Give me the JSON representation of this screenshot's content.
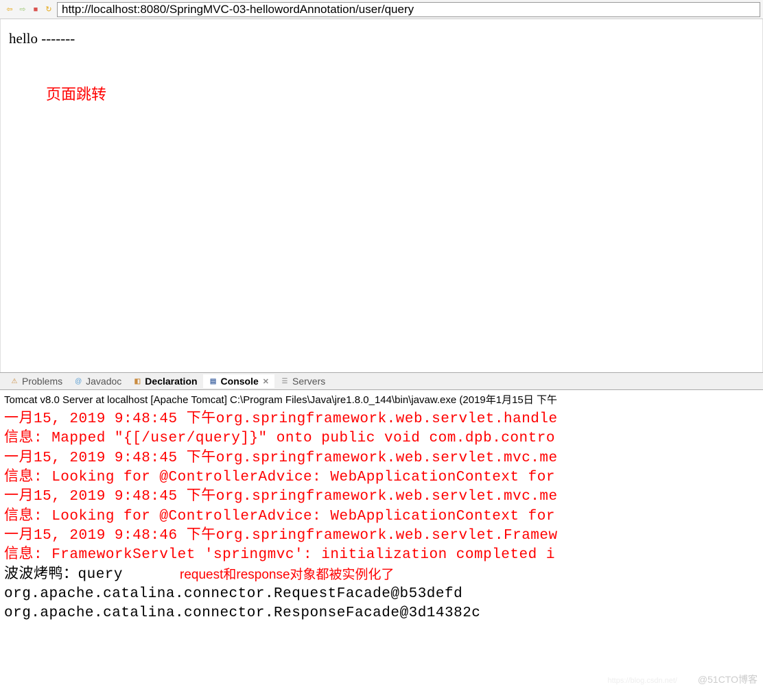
{
  "toolbar": {
    "url": "http://localhost:8080/SpringMVC-03-hellowordAnnotation/user/query"
  },
  "browser": {
    "body_text": "hello -------"
  },
  "annotations": {
    "page_redirect": "页面跳转",
    "request_response": "request和response对象都被实例化了"
  },
  "tabs": [
    {
      "label": "Problems",
      "icon": "problems"
    },
    {
      "label": "Javadoc",
      "icon": "javadoc"
    },
    {
      "label": "Declaration",
      "icon": "declaration",
      "bold": true
    },
    {
      "label": "Console",
      "icon": "console",
      "active": true
    },
    {
      "label": "Servers",
      "icon": "servers"
    }
  ],
  "console": {
    "header": "Tomcat v8.0 Server at localhost [Apache Tomcat] C:\\Program Files\\Java\\jre1.8.0_144\\bin\\javaw.exe (2019年1月15日 下午",
    "lines": [
      {
        "color": "red",
        "text": "一月15, 2019 9:48:45 下午org.springframework.web.servlet.handle"
      },
      {
        "color": "red",
        "text": "信息: Mapped \"{[/user/query]}\" onto public void com.dpb.contro"
      },
      {
        "color": "red",
        "text": "一月15, 2019 9:48:45 下午org.springframework.web.servlet.mvc.me"
      },
      {
        "color": "red",
        "text": "信息: Looking for @ControllerAdvice: WebApplicationContext for"
      },
      {
        "color": "red",
        "text": "一月15, 2019 9:48:45 下午org.springframework.web.servlet.mvc.me"
      },
      {
        "color": "red",
        "text": "信息: Looking for @ControllerAdvice: WebApplicationContext for"
      },
      {
        "color": "red",
        "text": "一月15, 2019 9:48:46 下午org.springframework.web.servlet.Framew"
      },
      {
        "color": "red",
        "text": "信息: FrameworkServlet 'springmvc': initialization completed i"
      },
      {
        "color": "black",
        "text": "波波烤鸭：query"
      },
      {
        "color": "black",
        "text": "org.apache.catalina.connector.RequestFacade@b53defd"
      },
      {
        "color": "black",
        "text": "org.apache.catalina.connector.ResponseFacade@3d14382c"
      }
    ]
  },
  "watermarks": {
    "left": "https://blog.csdn.net/",
    "right": "@51CTO博客"
  }
}
